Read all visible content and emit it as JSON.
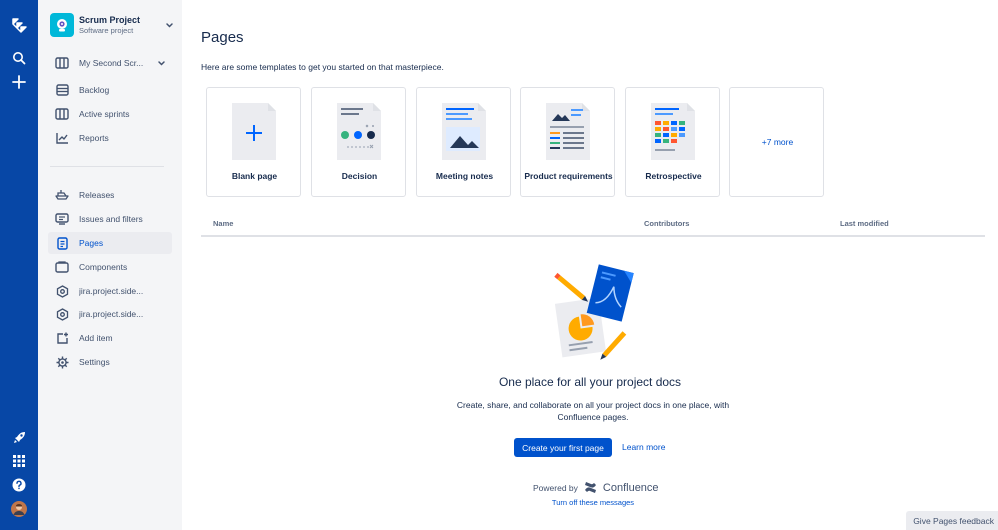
{
  "project": {
    "name": "Scrum Project",
    "type": "Software project"
  },
  "sidebar": {
    "board": {
      "label": "My Second Scr...",
      "icon": "board-icon"
    },
    "planning": [
      {
        "label": "Backlog",
        "icon": "backlog-icon"
      },
      {
        "label": "Active sprints",
        "icon": "board-columns-icon"
      },
      {
        "label": "Reports",
        "icon": "graph-line-icon"
      }
    ],
    "items": [
      {
        "label": "Releases",
        "icon": "ship-icon"
      },
      {
        "label": "Issues and filters",
        "icon": "issues-icon"
      },
      {
        "label": "Pages",
        "icon": "page-icon",
        "active": true
      },
      {
        "label": "Components",
        "icon": "component-icon"
      },
      {
        "label": "jira.project.side...",
        "icon": "hexagon-icon"
      },
      {
        "label": "jira.project.side...",
        "icon": "hexagon-icon"
      },
      {
        "label": "Add item",
        "icon": "add-item-icon"
      },
      {
        "label": "Settings",
        "icon": "gear-icon"
      }
    ]
  },
  "main": {
    "title": "Pages",
    "subtitle": "Here are some templates to get you started on that masterpiece.",
    "templates": [
      {
        "label": "Blank page"
      },
      {
        "label": "Decision"
      },
      {
        "label": "Meeting notes"
      },
      {
        "label": "Product requirements"
      },
      {
        "label": "Retrospective"
      }
    ],
    "more_templates": "+7 more",
    "table": {
      "col_name": "Name",
      "col_contributors": "Contributors",
      "col_modified": "Last modified"
    },
    "empty": {
      "title": "One place for all your project docs",
      "description": "Create, share, and collaborate on all your project docs in one place, with Confluence pages.",
      "primary_button": "Create your first page",
      "learn_more": "Learn more",
      "powered_by": "Powered by",
      "confluence": "Confluence",
      "turn_off": "Turn off these messages"
    },
    "feedback": "Give Pages feedback"
  },
  "colors": {
    "global_nav": "#0747a6",
    "primary": "#0052cc",
    "sidebar_bg": "#f4f5f7",
    "text": "#172b4d"
  }
}
